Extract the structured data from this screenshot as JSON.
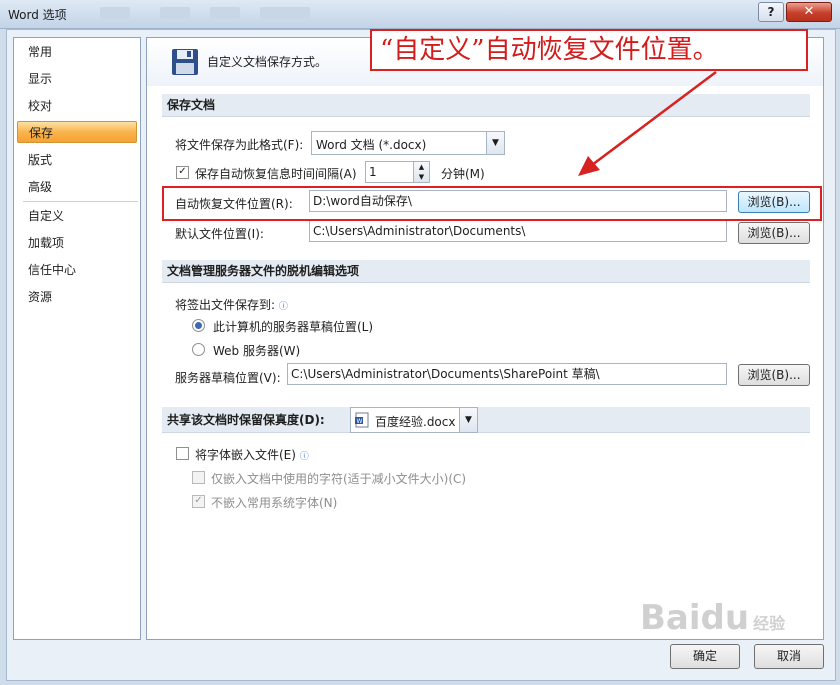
{
  "window": {
    "title": "Word 选项"
  },
  "sidebar": {
    "items": [
      {
        "label": "常用",
        "selected": false
      },
      {
        "label": "显示",
        "selected": false
      },
      {
        "label": "校对",
        "selected": false
      },
      {
        "label": "保存",
        "selected": true
      },
      {
        "label": "版式",
        "selected": false
      },
      {
        "label": "高级",
        "selected": false
      },
      {
        "label": "自定义",
        "selected": false
      },
      {
        "label": "加载项",
        "selected": false
      },
      {
        "label": "信任中心",
        "selected": false
      },
      {
        "label": "资源",
        "selected": false
      }
    ]
  },
  "header": {
    "title": "自定义文档保存方式。"
  },
  "save_docs": {
    "heading": "保存文档",
    "format_label": "将文件保存为此格式(F):",
    "format_value": "Word 文档 (*.docx)",
    "autorecover_checkbox_label": "保存自动恢复信息时间间隔(A)",
    "autorecover_checked": true,
    "interval_value": "1",
    "minutes_label": "分钟(M)",
    "autorecover_location_label": "自动恢复文件位置(R):",
    "autorecover_location_value": "D:\\word自动保存\\",
    "default_location_label": "默认文件位置(I):",
    "default_location_value": "C:\\Users\\Administrator\\Documents\\",
    "browse_label": "浏览(B)..."
  },
  "offline": {
    "heading": "文档管理服务器文件的脱机编辑选项",
    "save_checkout_label": "将签出文件保存到:",
    "option_local_label": "此计算机的服务器草稿位置(L)",
    "option_web_label": "Web 服务器(W)",
    "selected_option": "local",
    "drafts_location_label": "服务器草稿位置(V):",
    "drafts_location_value": "C:\\Users\\Administrator\\Documents\\SharePoint 草稿\\",
    "browse_label": "浏览(B)..."
  },
  "fidelity": {
    "heading": "共享该文档时保留保真度(D):",
    "document_value": "百度经验.docx",
    "embed_fonts_label": "将字体嵌入文件(E)",
    "embed_fonts_checked": false,
    "embed_used_chars_label": "仅嵌入文档中使用的字符(适于减小文件大小)(C)",
    "embed_used_chars_checked": false,
    "no_common_fonts_label": "不嵌入常用系统字体(N)",
    "no_common_fonts_checked": true
  },
  "footer": {
    "ok_label": "确定",
    "cancel_label": "取消"
  },
  "annotation": {
    "text": "“自定义”自动恢复文件位置。"
  },
  "watermark": {
    "text": "Baidu",
    "sub": "经验"
  },
  "icons": {
    "help": "question-icon",
    "close": "close-icon",
    "header": "floppy-disk-icon",
    "info": "info-icon",
    "dropdown": "chevron-down-icon",
    "doc": "word-document-icon"
  },
  "colors": {
    "accent": "#f9b44d",
    "annotation_red": "#d82121",
    "section_bg": "#e5ebf3"
  }
}
